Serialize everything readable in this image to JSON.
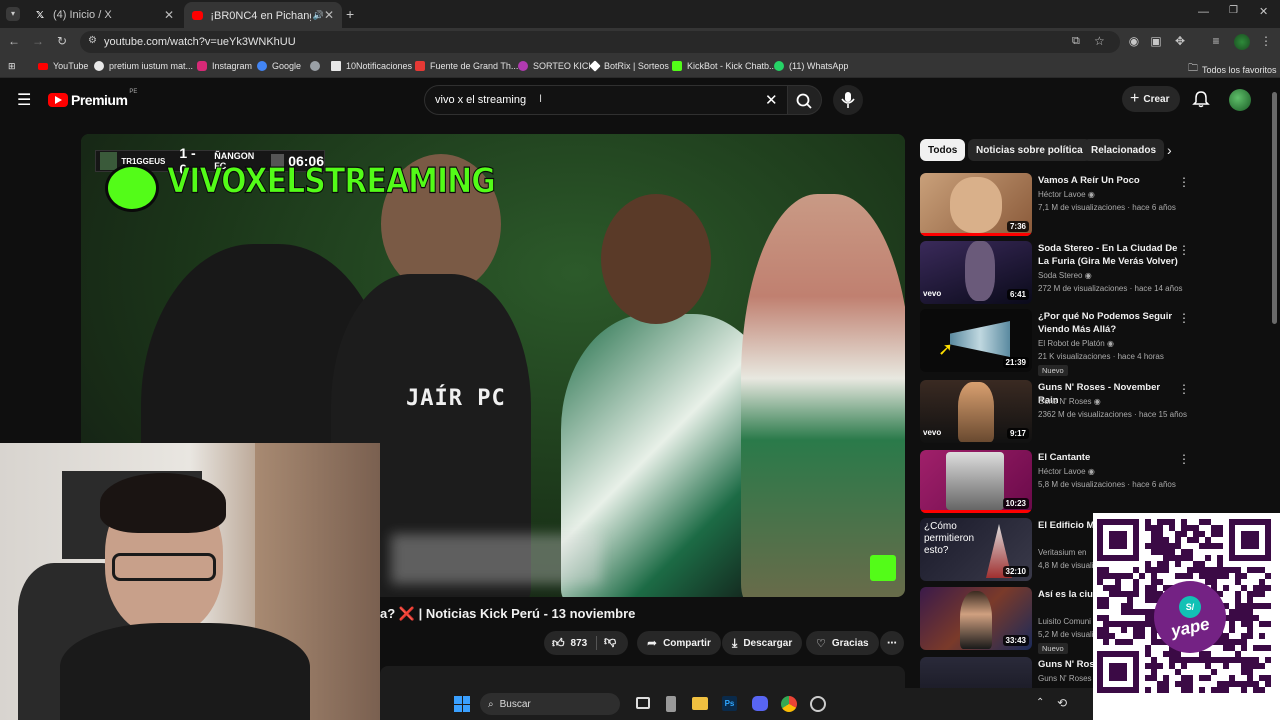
{
  "browser": {
    "tabs": [
      {
        "label": "(4) Inicio / X",
        "icon": "x-logo-icon",
        "active": false
      },
      {
        "label": "¡BR0NC4 en Pichanga! 🔴",
        "icon": "youtube-favicon-icon",
        "active": true
      }
    ],
    "new_tab_label": "+",
    "url": "youtube.com/watch?v=ueYk3WNKhUU",
    "bookmarks": [
      {
        "label": "YouTube",
        "color": "#ff0000"
      },
      {
        "label": "pretium iustum mat...",
        "color": "#e8e8e8"
      },
      {
        "label": "Instagram",
        "color": "#d62976"
      },
      {
        "label": "Google",
        "color": "#4285f4"
      },
      {
        "label": "",
        "color": "#9aa0a6"
      },
      {
        "label": "10Notificaciones",
        "color": "#e8e8e8"
      },
      {
        "label": "Fuente de Grand Th...",
        "color": "#e53935"
      },
      {
        "label": "SORTEO KICK",
        "color": "#b03ab0"
      },
      {
        "label": "BotRix | Sorteos",
        "color": "#ffffff"
      },
      {
        "label": "KickBot - Kick Chatb...",
        "color": "#53fc18"
      },
      {
        "label": "(11) WhatsApp",
        "color": "#25d366"
      }
    ],
    "all_bookmarks_label": "Todos los favoritos"
  },
  "youtube": {
    "logo_text": "Premium",
    "logo_region": "PE",
    "search_value": "vivo x el streaming",
    "create_label": "Crear",
    "video": {
      "overlay_team_left": "TR1GGEUS",
      "overlay_score": "1 - 0",
      "overlay_team_right": "ÑANGON FC",
      "overlay_clock": "06:06",
      "overlay_banner": "VIVOXELSTREAMING",
      "overlay_name": "JAÍR PC"
    },
    "video_title": "a? ❌ | Noticias Kick Perú - 13 noviembre",
    "actions": {
      "likes": "873",
      "share": "Compartir",
      "download": "Descargar",
      "thanks": "Gracias"
    },
    "chips": [
      "Todos",
      "Noticias sobre política",
      "Relacionados"
    ],
    "recommendations": [
      {
        "title": "Vamos A Reír Un Poco",
        "channel": "Héctor Lavoe",
        "meta": "7,1 M de visualizaciones · hace 6 años",
        "duration": "7:36",
        "badge": ""
      },
      {
        "title": "Soda Stereo - En La Ciudad De La Furia (Gira Me Verás Volver)",
        "channel": "Soda Stereo",
        "meta": "272 M de visualizaciones · hace 14 años",
        "duration": "6:41",
        "badge": ""
      },
      {
        "title": "¿Por qué No Podemos Seguir Viendo Más Allá?",
        "channel": "El Robot de Platón",
        "meta": "21 K visualizaciones · hace 4 horas",
        "duration": "21:39",
        "badge": "Nuevo"
      },
      {
        "title": "Guns N' Roses - November Rain",
        "channel": "Guns N' Roses",
        "meta": "2362 M de visualizaciones · hace 15 años",
        "duration": "9:17",
        "badge": ""
      },
      {
        "title": "El Cantante",
        "channel": "Héctor Lavoe",
        "meta": "5,8 M de visualizaciones · hace 6 años",
        "duration": "10:23",
        "badge": ""
      },
      {
        "title": "El Edificio Má Manhattan",
        "channel": "Veritasium en",
        "meta": "4,8 M de visuali",
        "duration": "32:10",
        "badge": ""
      },
      {
        "title": "Así es la ciud de todo el mu",
        "channel": "Luisito Comuni",
        "meta": "5,2 M de visuali",
        "duration": "33:43",
        "badge": "Nuevo"
      },
      {
        "title": "Guns N' Rose",
        "channel": "Guns N' Roses",
        "meta": "",
        "duration": "",
        "badge": ""
      }
    ],
    "thumb_texts": {
      "cuomo": "¿Cómo permitieron esto?",
      "vevo": "vevo"
    }
  },
  "taskbar": {
    "search_label": "Buscar"
  },
  "qr": {
    "brand": "yape",
    "logo": "S/"
  }
}
